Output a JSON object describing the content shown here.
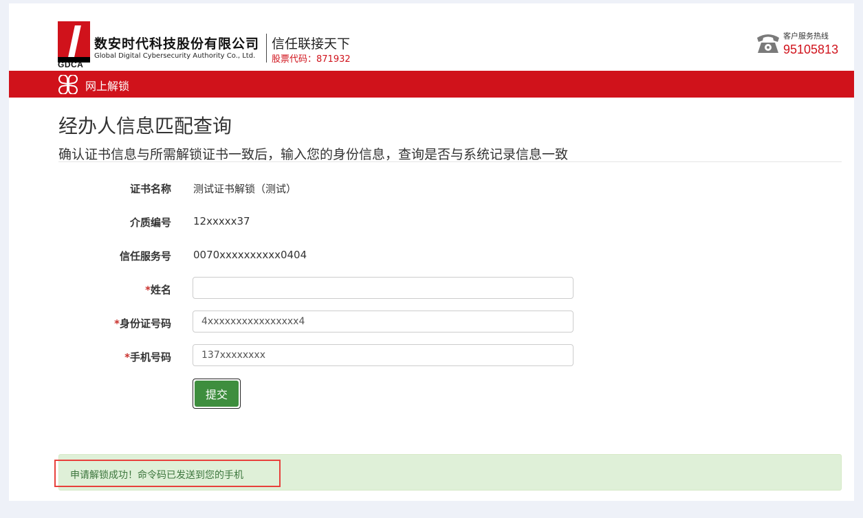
{
  "header": {
    "logo_abbr": "GDCA",
    "company_cn": "数安时代科技股份有限公司",
    "company_en": "Global Digital Cybersecurity Authority Co., Ltd.",
    "slogan": "信任联接天下",
    "stock_code": "股票代码：871932",
    "hotline_label": "客户服务热线",
    "hotline_number": "95105813",
    "brand_color": "#d0121b"
  },
  "nav": {
    "label": "网上解锁",
    "icon": "clover-grid-icon"
  },
  "page": {
    "title": "经办人信息匹配查询",
    "subtitle": "确认证书信息与所需解锁证书一致后，输入您的身份信息，查询是否与系统记录信息一致"
  },
  "form": {
    "cert_name_label": "证书名称",
    "cert_name_value": "测试证书解锁（测试）",
    "media_no_label": "介质编号",
    "media_no_value": "12xxxxx37",
    "trust_service_label": "信任服务号",
    "trust_service_value": "0070xxxxxxxxxx0404",
    "required_mark": "*",
    "name_label": "姓名",
    "name_value": "",
    "id_label": "身份证号码",
    "id_value": "4xxxxxxxxxxxxxxxx4",
    "phone_label": "手机号码",
    "phone_value": "137xxxxxxxx",
    "submit_label": "提交"
  },
  "alert": {
    "message": "申请解锁成功！命令码已发送到您的手机"
  }
}
